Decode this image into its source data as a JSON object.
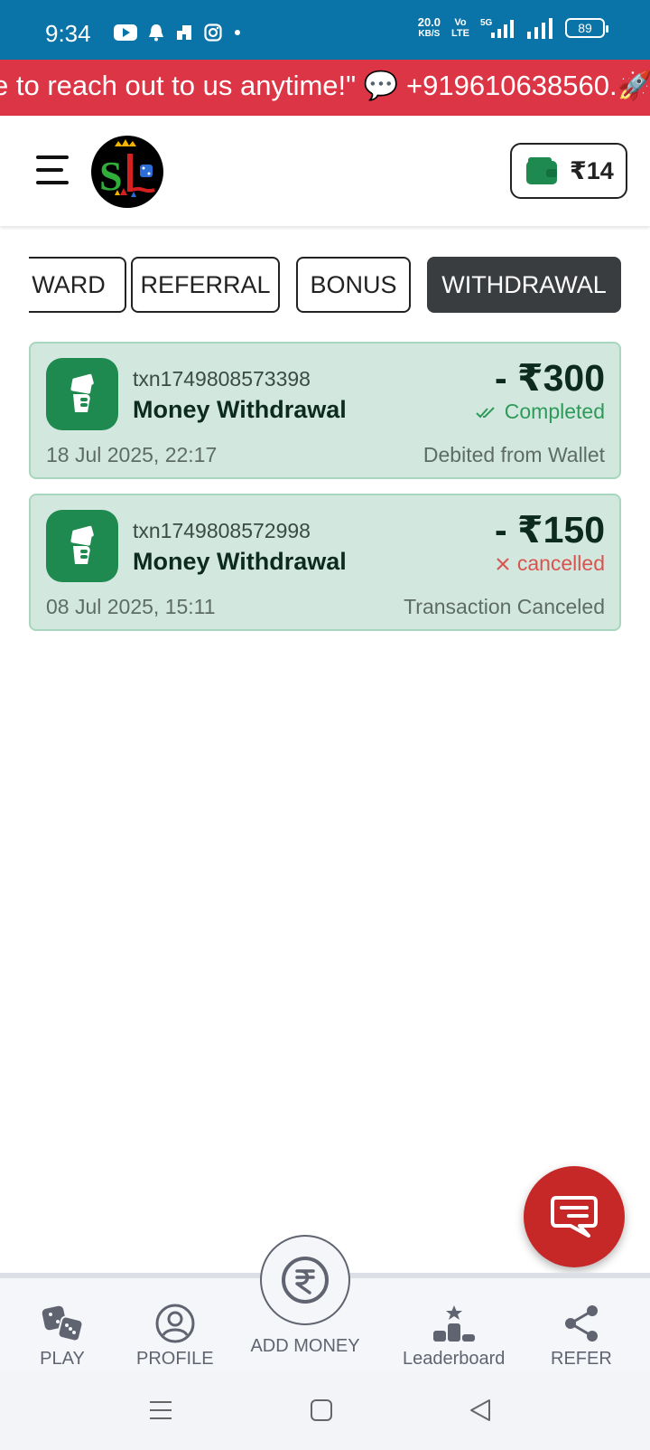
{
  "status_bar": {
    "time": "9:34",
    "net_speed_value": "20.0",
    "net_speed_unit": "KB/S",
    "volte_top": "Vo",
    "volte_bottom": "LTE",
    "battery": "89"
  },
  "banner": {
    "text": "e to reach out to us anytime!\" 💬 +919610638560.🚀"
  },
  "header": {
    "wallet_amount": "₹14"
  },
  "tabs": [
    {
      "label": "WARD",
      "active": false
    },
    {
      "label": "REFERRAL",
      "active": false
    },
    {
      "label": "BONUS",
      "active": false
    },
    {
      "label": "WITHDRAWAL",
      "active": true
    }
  ],
  "transactions": [
    {
      "txn_id": "txn1749808573398",
      "title": "Money Withdrawal",
      "amount": "- ₹300",
      "status": "Completed",
      "date": "18 Jul 2025, 22:17",
      "note": "Debited from Wallet"
    },
    {
      "txn_id": "txn1749808572998",
      "title": "Money Withdrawal",
      "amount": "- ₹150",
      "status": "cancelled",
      "date": "08 Jul 2025, 15:11",
      "note": "Transaction Canceled"
    }
  ],
  "bottom_nav": {
    "play": "PLAY",
    "profile": "PROFILE",
    "add_money": "ADD MONEY",
    "leaderboard": "Leaderboard",
    "refer": "REFER"
  },
  "colors": {
    "status_bar": "#0a74a8",
    "banner": "#dc3545",
    "card_bg": "#d2e8de",
    "accent_green": "#1e8a4f",
    "fab": "#c62828",
    "active_tab": "#3a3d40"
  }
}
